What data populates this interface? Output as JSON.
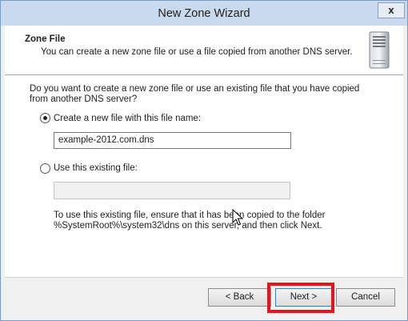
{
  "window": {
    "title": "New Zone Wizard",
    "close_label": "x"
  },
  "header": {
    "title": "Zone File",
    "subtitle": "You can create a new zone file or use a file copied from another DNS server.",
    "icon": "server-icon"
  },
  "body": {
    "question": "Do you want to create a new zone file or use an existing file that you have copied from another DNS server?",
    "option_new": {
      "label": "Create a new file with this file name:",
      "selected": true
    },
    "file_name_value": "example-2012.com.dns",
    "option_existing": {
      "label": "Use this existing file:",
      "selected": false
    },
    "existing_file_value": "",
    "note": "To use this existing file, ensure that it has been copied to the folder %SystemRoot%\\system32\\dns on this server, and then click Next."
  },
  "buttons": {
    "back": "< Back",
    "next": "Next >",
    "cancel": "Cancel"
  },
  "colors": {
    "titlebar": "#c9d9ee",
    "highlight": "#e8141c",
    "next_border": "#3c7fb1"
  }
}
